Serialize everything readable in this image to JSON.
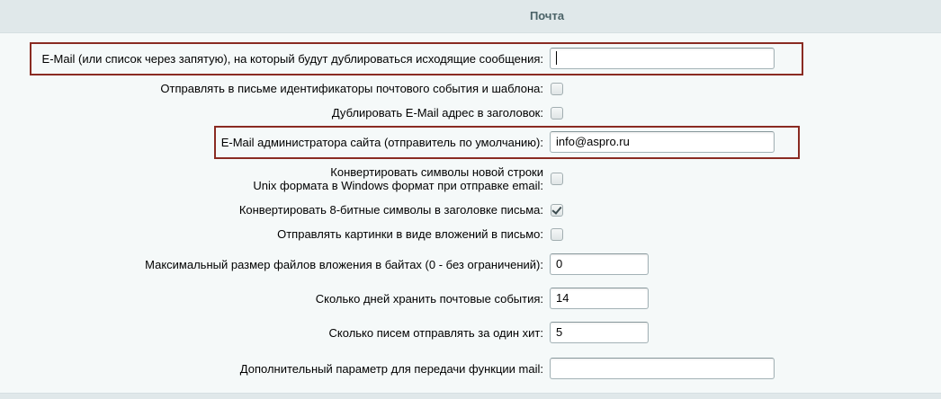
{
  "section": {
    "title": "Почта"
  },
  "fields": {
    "duplicate_email": {
      "label": "E-Mail (или список через запятую), на который будут дублироваться исходящие сообщения:",
      "value": ""
    },
    "send_event_ids": {
      "label": "Отправлять в письме идентификаторы почтового события и шаблона:",
      "checked": false
    },
    "duplicate_in_header": {
      "label": "Дублировать E-Mail адрес в заголовок:",
      "checked": false
    },
    "admin_email": {
      "label": "E-Mail администратора сайта (отправитель по умолчанию):",
      "value": "info@aspro.ru"
    },
    "convert_newlines": {
      "label_line1": "Конвертировать символы новой строки",
      "label_line2": "Unix формата в Windows формат при отправке email:",
      "checked": false
    },
    "convert_8bit": {
      "label": "Конвертировать 8-битные символы в заголовке письма:",
      "checked": true
    },
    "images_as_attachments": {
      "label": "Отправлять картинки в виде вложений в письмо:",
      "checked": false
    },
    "max_attachment_size": {
      "label": "Максимальный размер файлов вложения в байтах (0 - без ограничений):",
      "value": "0"
    },
    "keep_events_days": {
      "label": "Сколько дней хранить почтовые события:",
      "value": "14"
    },
    "emails_per_hit": {
      "label": "Сколько писем отправлять за один хит:",
      "value": "5"
    },
    "mail_extra_param": {
      "label": "Дополнительный параметр для передачи функции mail:",
      "value": ""
    }
  },
  "colors": {
    "highlight_border": "#8a2b22",
    "header_text": "#4b6267",
    "panel_background": "#f5f9f9"
  }
}
